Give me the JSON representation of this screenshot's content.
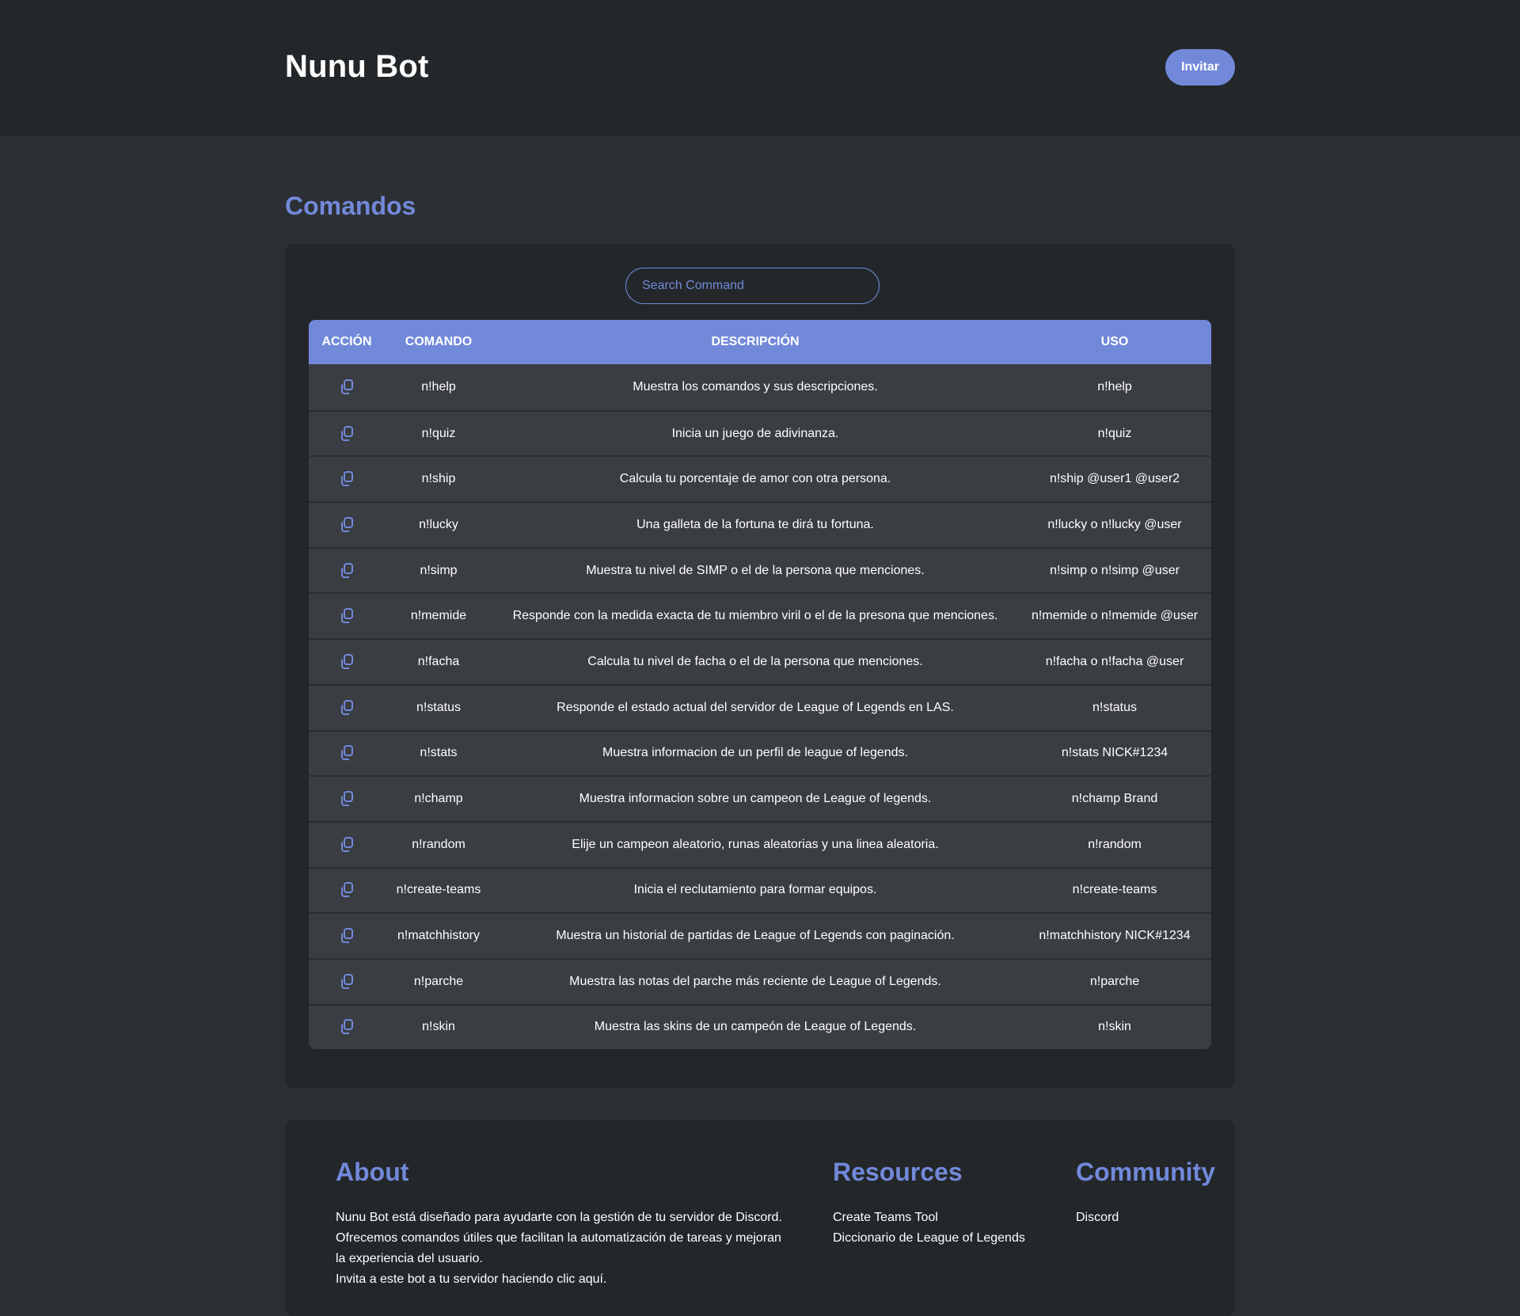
{
  "header": {
    "brand": "Nunu Bot",
    "invite_label": "Invitar"
  },
  "commands_section": {
    "title": "Comandos",
    "search": {
      "placeholder": "Search Command",
      "value": ""
    },
    "columns": {
      "accion": "ACCIÓN",
      "comando": "COMANDO",
      "descripcion": "DESCRIPCIÓN",
      "uso": "USO"
    },
    "action_icon": "copy-icon",
    "rows": [
      {
        "comando": "n!help",
        "descripcion": "Muestra los comandos y sus descripciones.",
        "uso": "n!help"
      },
      {
        "comando": "n!quiz",
        "descripcion": "Inicia un juego de adivinanza.",
        "uso": "n!quiz"
      },
      {
        "comando": "n!ship",
        "descripcion": "Calcula tu porcentaje de amor con otra persona.",
        "uso": "n!ship @user1 @user2"
      },
      {
        "comando": "n!lucky",
        "descripcion": "Una galleta de la fortuna te dirá tu fortuna.",
        "uso": "n!lucky o n!lucky @user"
      },
      {
        "comando": "n!simp",
        "descripcion": "Muestra tu nivel de SIMP o el de la persona que menciones.",
        "uso": "n!simp o n!simp @user"
      },
      {
        "comando": "n!memide",
        "descripcion": "Responde con la medida exacta de tu miembro viril o el de la presona que menciones.",
        "uso": "n!memide o n!memide @user"
      },
      {
        "comando": "n!facha",
        "descripcion": "Calcula tu nivel de facha o el de la persona que menciones.",
        "uso": "n!facha o n!facha @user"
      },
      {
        "comando": "n!status",
        "descripcion": "Responde el estado actual del servidor de League of Legends en LAS.",
        "uso": "n!status"
      },
      {
        "comando": "n!stats",
        "descripcion": "Muestra informacion de un perfil de league of legends.",
        "uso": "n!stats NICK#1234"
      },
      {
        "comando": "n!champ",
        "descripcion": "Muestra informacion sobre un campeon de League of legends.",
        "uso": "n!champ Brand"
      },
      {
        "comando": "n!random",
        "descripcion": "Elije un campeon aleatorio, runas aleatorias y una linea aleatoria.",
        "uso": "n!random"
      },
      {
        "comando": "n!create-teams",
        "descripcion": "Inicia el reclutamiento para formar equipos.",
        "uso": "n!create-teams"
      },
      {
        "comando": "n!matchhistory",
        "descripcion": "Muestra un historial de partidas de League of Legends con paginación.",
        "uso": "n!matchhistory NICK#1234"
      },
      {
        "comando": "n!parche",
        "descripcion": "Muestra las notas del parche más reciente de League of Legends.",
        "uso": "n!parche"
      },
      {
        "comando": "n!skin",
        "descripcion": "Muestra las skins de un campeón de League of Legends.",
        "uso": "n!skin"
      }
    ]
  },
  "footer": {
    "about": {
      "title": "About",
      "lines": [
        "Nunu Bot está diseñado para ayudarte con la gestión de tu servidor de Discord.",
        "Ofrecemos comandos útiles que facilitan la automatización de tareas y mejoran",
        "la experiencia del usuario.",
        "Invita a este bot a tu servidor haciendo clic aquí."
      ]
    },
    "resources": {
      "title": "Resources",
      "links": [
        "Create Teams Tool",
        "Diccionario de League of Legends"
      ]
    },
    "community": {
      "title": "Community",
      "links": [
        "Discord"
      ]
    }
  },
  "colors": {
    "accent": "#7289da",
    "header_bg": "#23272a",
    "page_bg": "#2c2f33",
    "card_bg": "#23272a",
    "row_bg": "#3a3d42"
  }
}
